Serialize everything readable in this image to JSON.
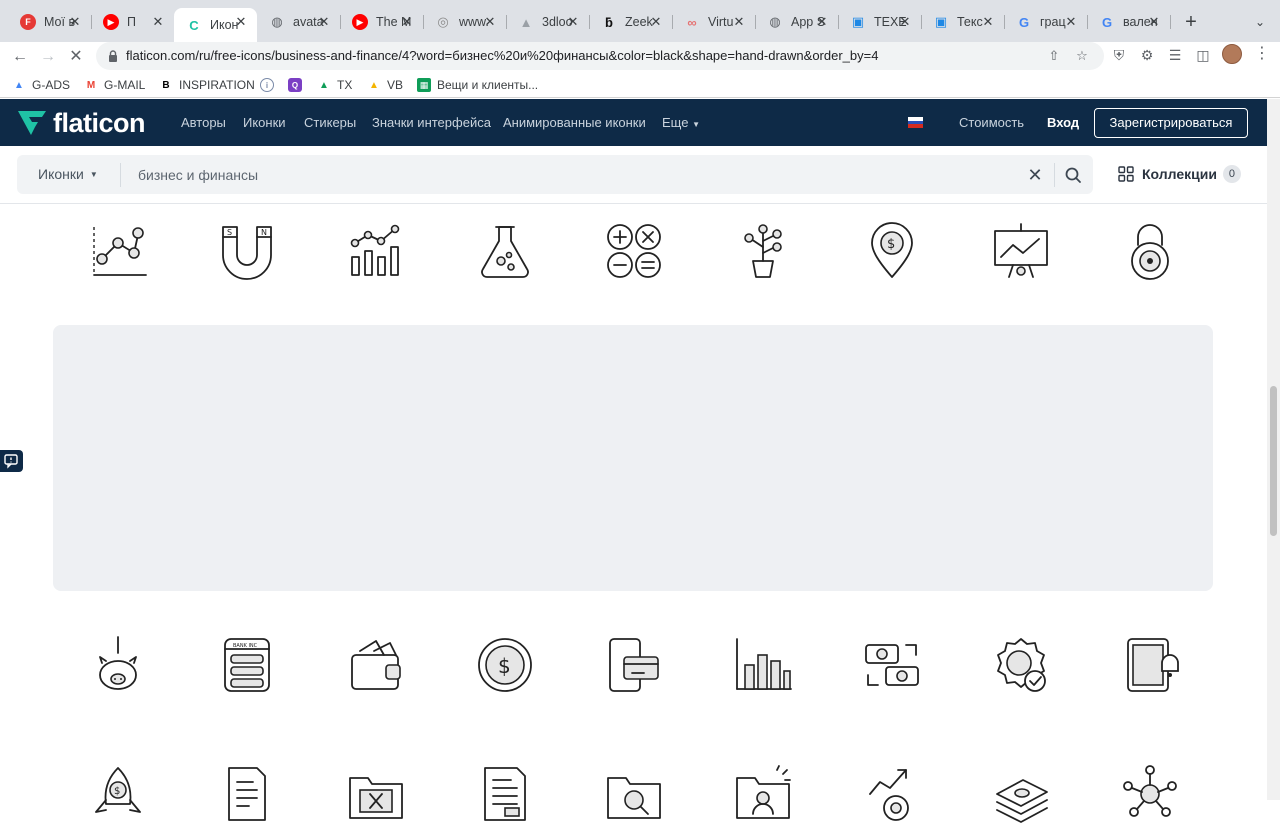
{
  "browser": {
    "tabs": [
      {
        "title": "Мої в",
        "favicon": "red-circle"
      },
      {
        "title": "П",
        "favicon": "youtube"
      },
      {
        "title": "Икон",
        "favicon": "flaticon",
        "active": true
      },
      {
        "title": "avata",
        "favicon": "globe"
      },
      {
        "title": "The M",
        "favicon": "youtube"
      },
      {
        "title": "www.",
        "favicon": "instagram"
      },
      {
        "title": "3dloo",
        "favicon": "triangle"
      },
      {
        "title": "Zeek",
        "favicon": "zeek"
      },
      {
        "title": "Virtu",
        "favicon": "virtu"
      },
      {
        "title": "App S",
        "favicon": "globe"
      },
      {
        "title": "TEXE",
        "favicon": "cube"
      },
      {
        "title": "Текс",
        "favicon": "cube"
      },
      {
        "title": "грац",
        "favicon": "google"
      },
      {
        "title": "вален",
        "favicon": "google"
      }
    ],
    "url": "flaticon.com/ru/free-icons/business-and-finance/4?word=бизнес%20и%20финансы&color=black&shape=hand-drawn&order_by=4",
    "bookmarks": [
      {
        "label": "G-ADS",
        "icon": "ads-icon"
      },
      {
        "label": "G-MAIL",
        "icon": "gmail-icon"
      },
      {
        "label": "INSPIRATION",
        "icon": "behance-icon"
      },
      {
        "label": "",
        "icon": "info-icon"
      },
      {
        "label": "",
        "icon": "app-icon"
      },
      {
        "label": "TX",
        "icon": "drive-icon"
      },
      {
        "label": "VB",
        "icon": "drive-icon"
      },
      {
        "label": "Вещи и клиенты...",
        "icon": "sheets-icon"
      }
    ]
  },
  "site": {
    "logo": "flaticon",
    "nav": [
      "Авторы",
      "Иконки",
      "Стикеры",
      "Значки интерфейса",
      "Анимированные иконки",
      "Еще"
    ],
    "pricing": "Стоимость",
    "login": "Вход",
    "signup": "Зарегистрироваться",
    "colors": {
      "nav_bg": "#0e2a47",
      "accent": "#1fc2a5"
    }
  },
  "search": {
    "type": "Иконки",
    "query": "бизнес и финансы",
    "collections_label": "Коллекции",
    "collections_count": "0"
  },
  "icons": {
    "row1": [
      "molecule-graph-icon",
      "magnet-icon",
      "bar-chart-nodes-icon",
      "flask-icon",
      "math-operations-icon",
      "money-plant-icon",
      "location-dollar-icon",
      "presentation-board-icon",
      "combination-lock-icon"
    ],
    "row2": [
      "piggy-bank-icon",
      "bank-card-icon",
      "wallet-icon",
      "dollar-coin-icon",
      "mobile-payment-icon",
      "bar-chart-icon",
      "money-exchange-icon",
      "quality-badge-icon",
      "tablet-notification-icon"
    ],
    "row3": [
      "rocket-money-icon",
      "document-icon",
      "folder-remove-icon",
      "invoice-icon",
      "folder-search-icon",
      "folder-user-icon",
      "growth-gear-icon",
      "money-stack-icon",
      "idea-network-icon"
    ]
  }
}
